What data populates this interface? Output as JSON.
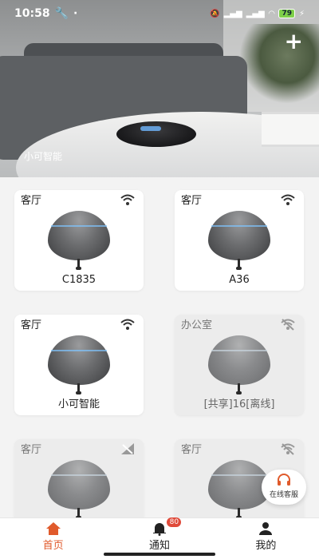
{
  "status": {
    "time": "10:58",
    "battery": "79"
  },
  "hero": {
    "label": "小可智能",
    "add_button": "+"
  },
  "cards": [
    {
      "room": "客厅",
      "name": "C1835",
      "status": "online"
    },
    {
      "room": "客厅",
      "name": "A36",
      "status": "online"
    },
    {
      "room": "客厅",
      "name": "小可智能",
      "status": "online"
    },
    {
      "room": "办公室",
      "name": "[共享]16[离线]",
      "status": "offline"
    },
    {
      "room": "客厅",
      "name": "",
      "status": "no-signal"
    },
    {
      "room": "客厅",
      "name": "",
      "status": "offline"
    }
  ],
  "chat": {
    "label": "在线客服"
  },
  "tabs": [
    {
      "label": "首页",
      "active": true
    },
    {
      "label": "通知",
      "badge": "80"
    },
    {
      "label": "我的"
    }
  ],
  "colors": {
    "accent": "#e05a2b",
    "badge": "#e04a3a"
  }
}
